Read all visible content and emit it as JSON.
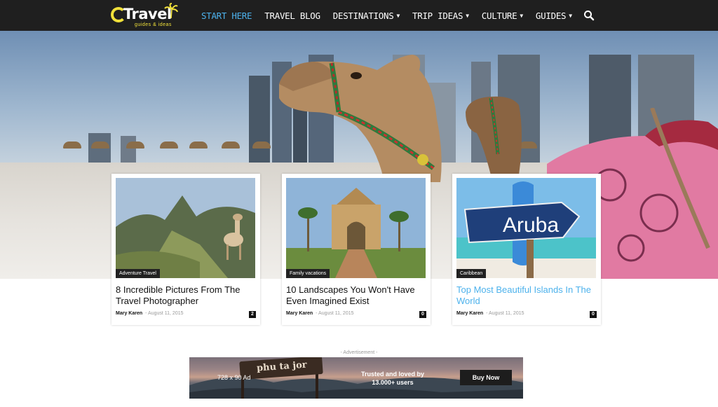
{
  "logo": {
    "text": "Travel",
    "tagline": "guides & ideas"
  },
  "nav": [
    {
      "label": "Start here",
      "active": true,
      "dropdown": false
    },
    {
      "label": "Travel blog",
      "active": false,
      "dropdown": false
    },
    {
      "label": "Destinations",
      "active": false,
      "dropdown": true
    },
    {
      "label": "Trip ideas",
      "active": false,
      "dropdown": true
    },
    {
      "label": "Culture",
      "active": false,
      "dropdown": true
    },
    {
      "label": "Guides",
      "active": false,
      "dropdown": true
    }
  ],
  "search_icon": "search-icon",
  "cards": [
    {
      "category": "Adventure Travel",
      "title": "8 Incredible Pictures From The Travel Photographer",
      "author": "Mary Karen",
      "date": "August 11, 2015",
      "comments": "2",
      "highlight": false
    },
    {
      "category": "Family vacations",
      "title": "10 Landscapes You Won't Have Even Imagined Exist",
      "author": "Mary Karen",
      "date": "August 11, 2015",
      "comments": "0",
      "highlight": false
    },
    {
      "category": "Caribbean",
      "title": "Top Most Beautiful Islands In The World",
      "author": "Mary Karen",
      "date": "August 11, 2015",
      "comments": "0",
      "highlight": true,
      "sign_text": "Aruba"
    }
  ],
  "ad": {
    "label": "- Advertisement -",
    "size": "728 x 90 Ad",
    "sign": "phu ta jor",
    "trust_line1": "Trusted and loved by",
    "trust_line2": "13.000+ users",
    "button": "Buy Now"
  },
  "colors": {
    "accent": "#4db2ec",
    "header_bg": "#1f1f1f",
    "logo_yellow": "#f0e03a"
  }
}
